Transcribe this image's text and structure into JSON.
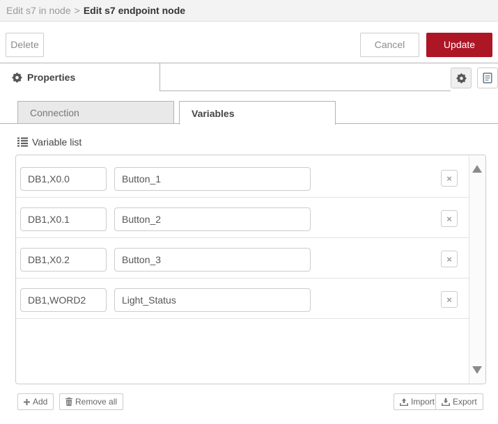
{
  "header": {
    "breadcrumb": {
      "parent": "Edit s7 in node",
      "separator": ">",
      "current": "Edit s7 endpoint node"
    }
  },
  "toolbar": {
    "delete_label": "Delete",
    "cancel_label": "Cancel",
    "update_label": "Update"
  },
  "properties_bar": {
    "title": "Properties",
    "icons": {
      "title_icon": "gear-icon",
      "edit_properties_icon": "gear-icon",
      "edit_description_icon": "file-text-icon"
    }
  },
  "tabs": {
    "connection_label": "Connection",
    "variables_label": "Variables",
    "active_tab": "Variables"
  },
  "variable_list": {
    "label": "Variable list",
    "label_icon": "list-icon",
    "remove_row_glyph": "×",
    "rows": [
      {
        "address": "DB1,X0.0",
        "name": "Button_1"
      },
      {
        "address": "DB1,X0.1",
        "name": "Button_2"
      },
      {
        "address": "DB1,X0.2",
        "name": "Button_3"
      },
      {
        "address": "DB1,WORD2",
        "name": "Light_Status"
      }
    ]
  },
  "footer": {
    "add_label": "Add",
    "remove_all_label": "Remove all",
    "import_label": "Import",
    "export_label": "Export"
  },
  "colors": {
    "accent_red": "#ad1625",
    "header_bg": "#f3f3f3",
    "border_gray": "#b3b3b3",
    "inactive_tab_bg": "#e9e9e9"
  }
}
